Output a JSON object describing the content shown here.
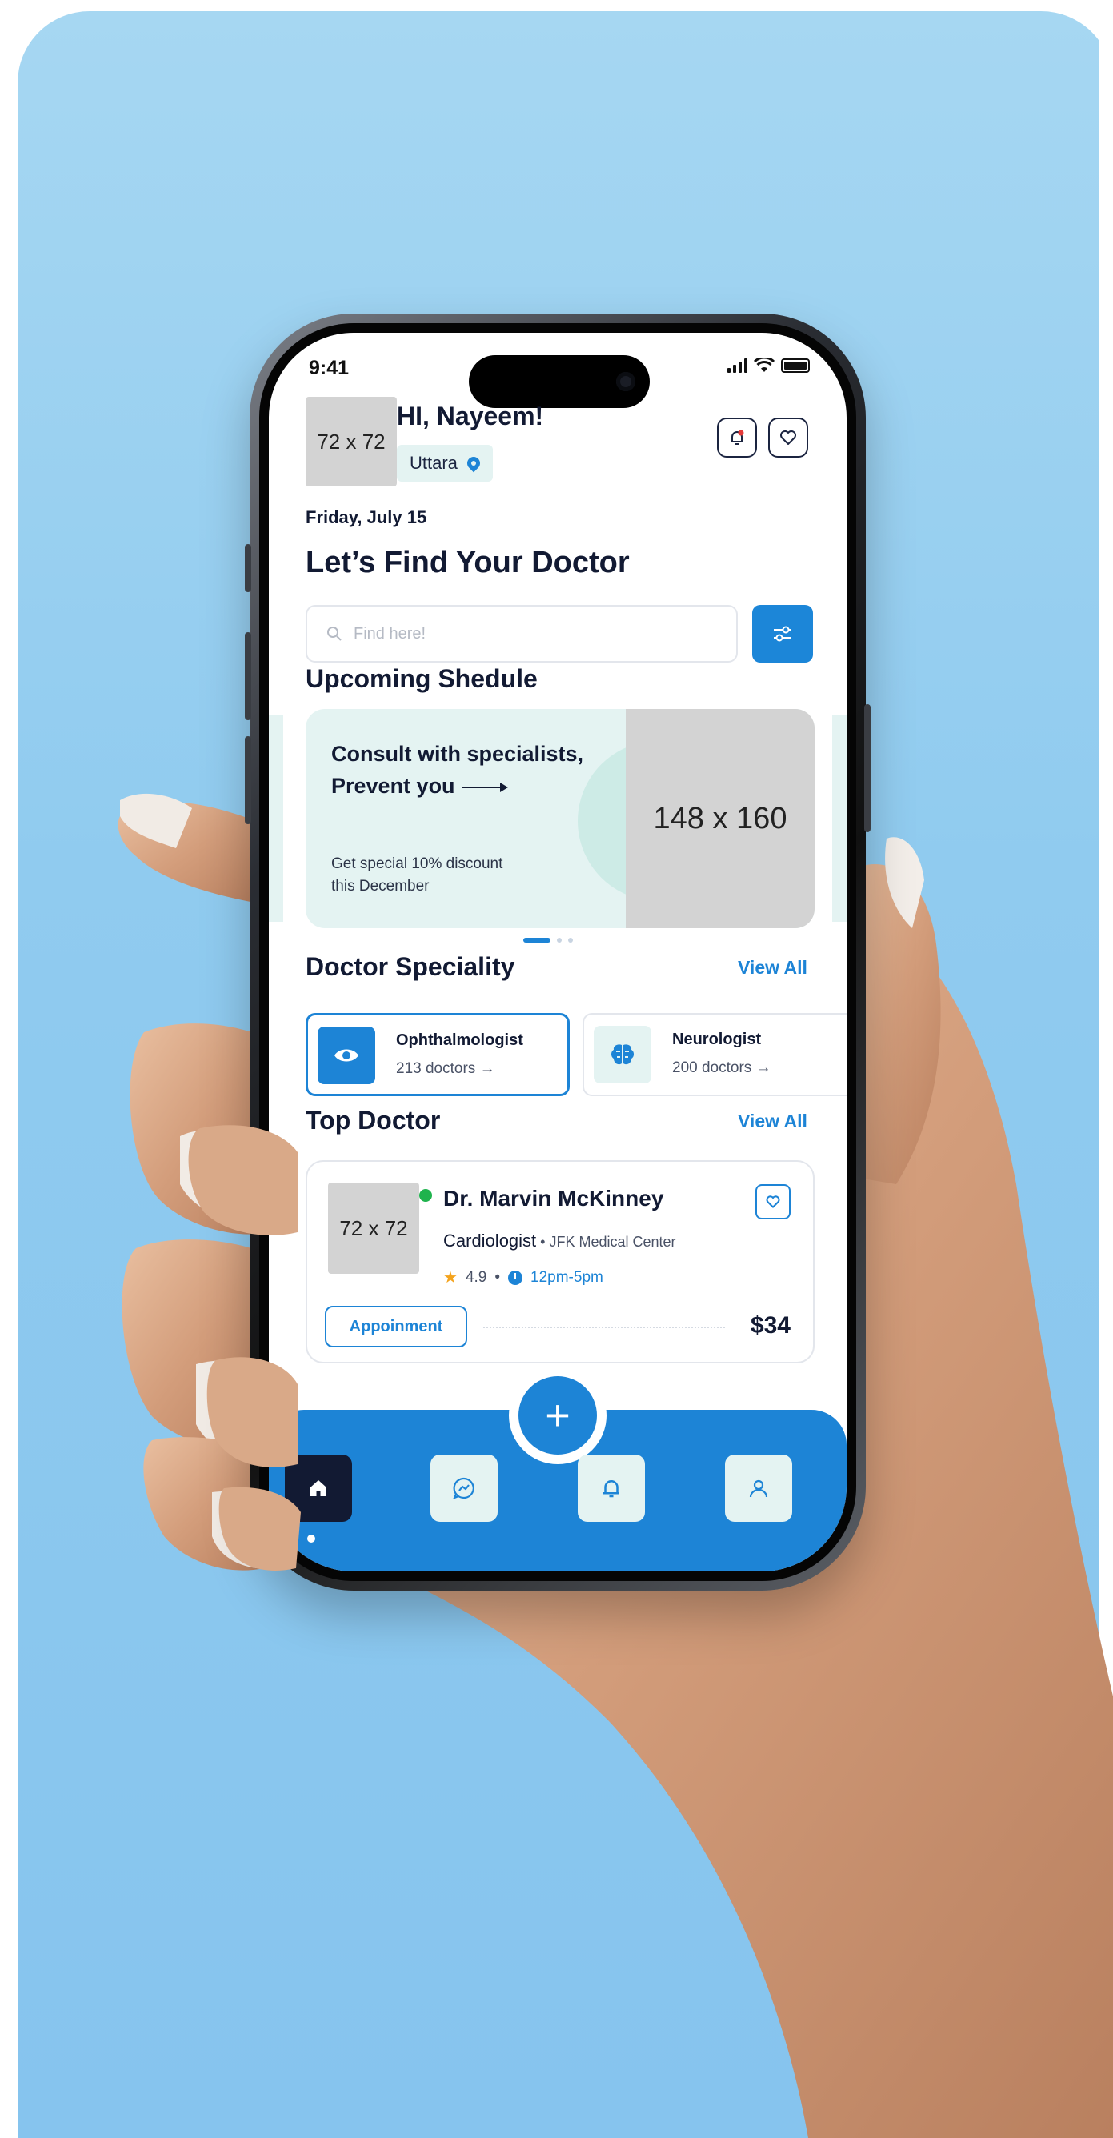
{
  "status_bar": {
    "time": "9:41"
  },
  "header": {
    "avatar_placeholder": "72 x 72",
    "greeting": "HI, Nayeem!",
    "location": "Uttara",
    "icons": [
      "bell-icon",
      "heart-icon"
    ]
  },
  "date": "Friday, July 15",
  "headline": "Let’s Find Your Doctor",
  "search": {
    "placeholder": "Find here!"
  },
  "upcoming": {
    "title": "Upcoming Shedule",
    "promo": {
      "title_line1": "Consult with specialists,",
      "title_line2": "Prevent you",
      "subtitle_line1": "Get special 10% discount",
      "subtitle_line2": "this December",
      "image_placeholder": "148 x 160"
    },
    "carousel_pages": 3,
    "carousel_active": 1
  },
  "speciality": {
    "title": "Doctor Speciality",
    "view_all": "View All",
    "items": [
      {
        "name": "Ophthalmologist",
        "count": "213 doctors →",
        "icon": "eye-icon"
      },
      {
        "name": "Neurologist",
        "count": "200 doctors →",
        "icon": "brain-icon"
      }
    ]
  },
  "top_doctor": {
    "title": "Top Doctor",
    "view_all": "View All",
    "card": {
      "avatar_placeholder": "72 x 72",
      "name": "Dr. Marvin McKinney",
      "specialty": "Cardiologist",
      "separator": " • ",
      "hospital": "JFK Medical Center",
      "rating": "4.9",
      "meta_sep": "•",
      "hours": "12pm-5pm",
      "button": "Appoinment",
      "price": "$34"
    }
  },
  "tabbar": {
    "fab": "+",
    "tabs": [
      "home-icon",
      "chat-icon",
      "bell-icon",
      "user-icon"
    ],
    "active": "home-icon"
  },
  "colors": {
    "primary": "#1d84d6",
    "dark": "#121a33",
    "mint": "#e4f3f2",
    "background": "#90cbef"
  }
}
